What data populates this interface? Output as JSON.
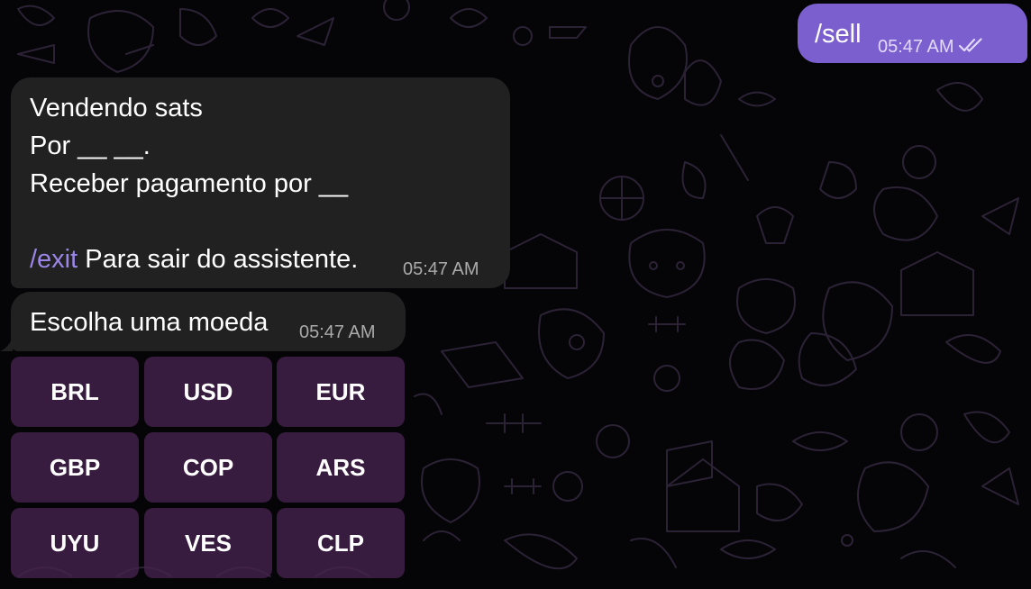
{
  "outgoing": {
    "text": "/sell",
    "time": "05:47 AM",
    "status_icon": "double-check-icon"
  },
  "message1": {
    "line1": "Vendendo sats",
    "line2": "Por __ __.",
    "line3": "Receber pagamento por __",
    "command": "/exit",
    "command_text": " Para sair do assistente.",
    "time": "05:47 AM"
  },
  "message2": {
    "text": "Escolha uma moeda",
    "time": "05:47 AM"
  },
  "keyboard": {
    "buttons": [
      "BRL",
      "USD",
      "EUR",
      "GBP",
      "COP",
      "ARS",
      "UYU",
      "VES",
      "CLP"
    ]
  },
  "colors": {
    "outgoing_bubble": "#7b5fcf",
    "incoming_bubble": "#212121",
    "command_link": "#9b86e8",
    "keyboard_button": "#44224c",
    "background": "#050507"
  }
}
